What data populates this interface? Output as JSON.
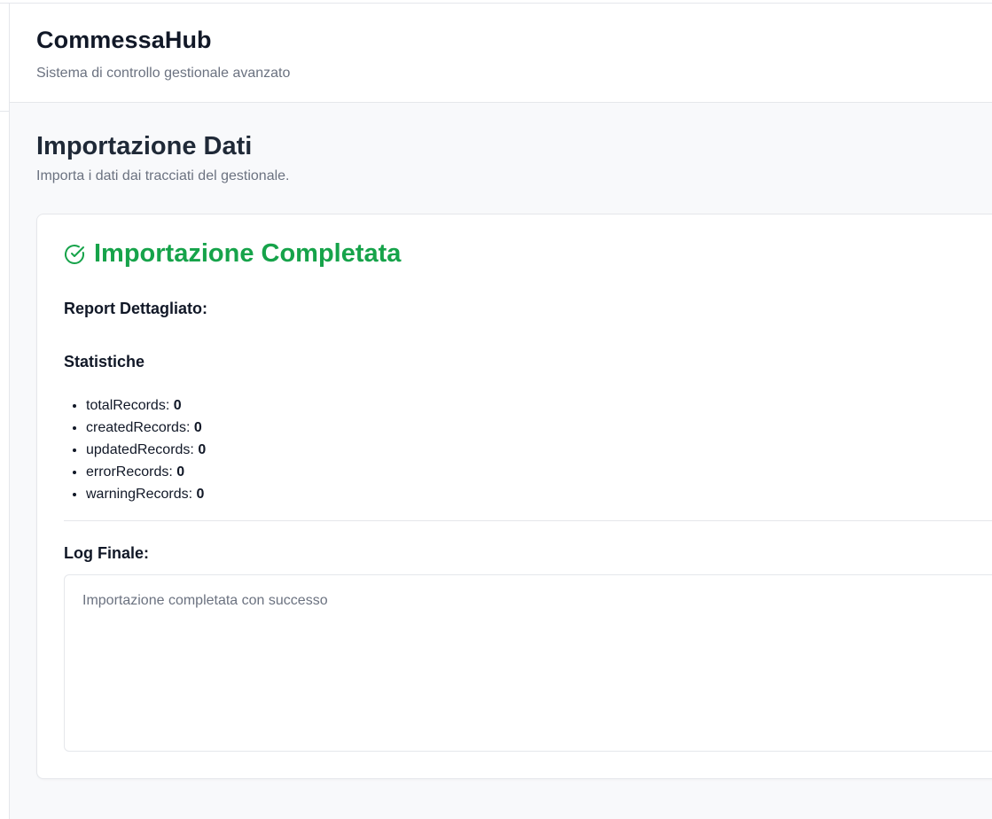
{
  "app": {
    "title": "CommessaHub",
    "subtitle": "Sistema di controllo gestionale avanzato"
  },
  "page": {
    "title": "Importazione Dati",
    "subtitle": "Importa i dati dai tracciati del gestionale."
  },
  "result": {
    "status_icon": "check-circle-icon",
    "status_color": "#16a34a",
    "status_title": "Importazione Completata",
    "report_heading": "Report Dettagliato:",
    "stats_heading": "Statistiche",
    "stats": [
      {
        "label": "totalRecords:",
        "value": "0"
      },
      {
        "label": "createdRecords:",
        "value": "0"
      },
      {
        "label": "updatedRecords:",
        "value": "0"
      },
      {
        "label": "errorRecords:",
        "value": "0"
      },
      {
        "label": "warningRecords:",
        "value": "0"
      }
    ],
    "log_heading": "Log Finale:",
    "log_text": "Importazione completata con successo"
  }
}
